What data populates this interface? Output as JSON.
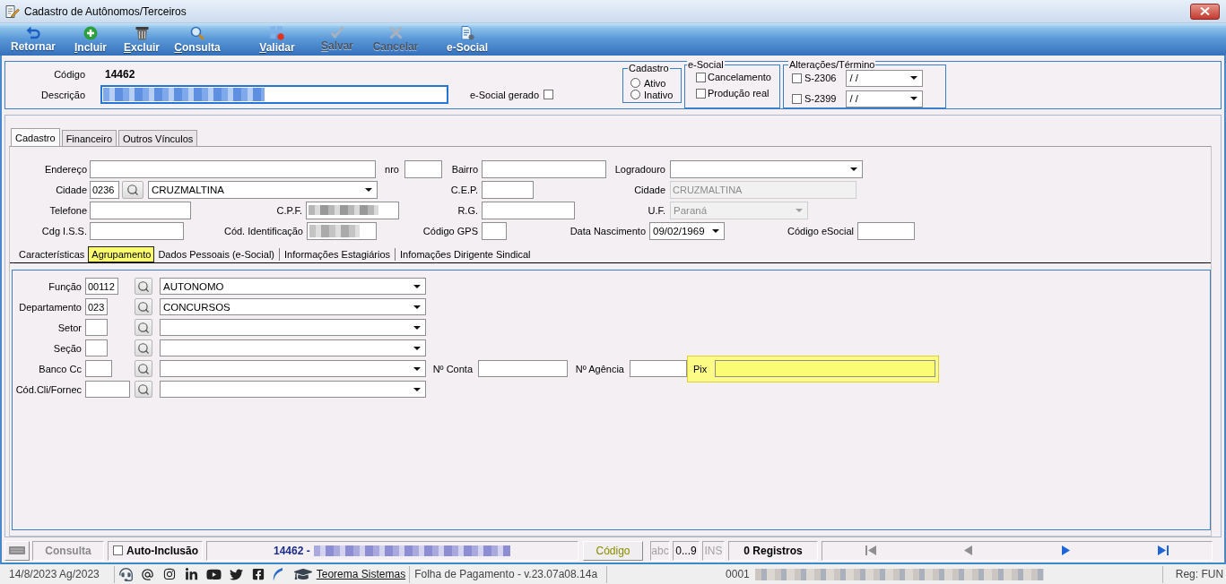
{
  "window": {
    "title": "Cadastro de Autônomos/Terceiros"
  },
  "toolbar": [
    {
      "kind": "return",
      "label": "Retornar",
      "disabled": false,
      "mnemonic": false
    },
    {
      "kind": "add",
      "label": "Incluir",
      "disabled": false,
      "mnemonic": true
    },
    {
      "kind": "delete",
      "label": "Excluir",
      "disabled": false,
      "mnemonic": true
    },
    {
      "kind": "search",
      "label": "Consulta",
      "disabled": false,
      "mnemonic": true
    },
    {
      "kind": "validate",
      "label": "Validar",
      "disabled": false,
      "mnemonic": true
    },
    {
      "kind": "save",
      "label": "Salvar",
      "disabled": true,
      "mnemonic": true
    },
    {
      "kind": "cancel",
      "label": "Cancelar",
      "disabled": true,
      "mnemonic": false
    },
    {
      "kind": "esocial",
      "label": "e-Social",
      "disabled": false,
      "mnemonic": false
    }
  ],
  "header": {
    "codigo": {
      "label": "Código",
      "value": "14462"
    },
    "descricao": {
      "label": "Descrição",
      "focused": true
    },
    "esocial_gerado": {
      "label": "e-Social gerado",
      "checked": false
    },
    "cadastro": {
      "title": "Cadastro",
      "options": [
        {
          "label": "Ativo",
          "selected": false
        },
        {
          "label": "Inativo",
          "selected": false
        }
      ]
    },
    "esocial": {
      "title": "e-Social",
      "options": [
        {
          "label": "Cancelamento",
          "checked": false
        },
        {
          "label": "Produção real",
          "checked": false
        }
      ]
    },
    "alteracoes": {
      "title": "Alterações/Término",
      "rows": [
        {
          "label": "S-2306",
          "checked": false,
          "value": "/ /"
        },
        {
          "label": "S-2399",
          "checked": false,
          "value": "/ /"
        }
      ]
    }
  },
  "tabs": [
    {
      "label": "Cadastro",
      "selected": true
    },
    {
      "label": "Financeiro",
      "selected": false
    },
    {
      "label": "Outros Vínculos",
      "selected": false
    }
  ],
  "cadastro": {
    "endereco": {
      "label": "Endereço"
    },
    "nro": {
      "label": "nro"
    },
    "bairro": {
      "label": "Bairro"
    },
    "logradouro": {
      "label": "Logradouro"
    },
    "cidade": {
      "label": "Cidade",
      "code": "0236",
      "value": "CRUZMALTINA"
    },
    "cep": {
      "label": "C.E.P."
    },
    "cidade_nome": {
      "label": "Cidade",
      "value": "CRUZMALTINA",
      "disabled": true
    },
    "telefone": {
      "label": "Telefone"
    },
    "cpf": {
      "label": "C.P.F."
    },
    "rg": {
      "label": "R.G."
    },
    "uf": {
      "label": "U.F.",
      "value": "Paraná",
      "disabled": true
    },
    "cdg_iss": {
      "label": "Cdg I.S.S."
    },
    "cod_identificacao": {
      "label": "Cód. Identificação"
    },
    "codigo_gps": {
      "label": "Código GPS"
    },
    "data_nascimento": {
      "label": "Data Nascimento",
      "value": "09/02/1969"
    },
    "codigo_esocial": {
      "label": "Código eSocial"
    }
  },
  "subtabs": [
    {
      "label": "Características",
      "selected": false
    },
    {
      "label": "Agrupamento",
      "selected": true
    },
    {
      "label": "Dados Pessoais (e-Social)",
      "selected": false
    },
    {
      "label": "Informações Estagiários",
      "selected": false
    },
    {
      "label": "Infomações Dirigente Sindical",
      "selected": false
    }
  ],
  "agrupamento": {
    "rows": [
      {
        "label": "Função",
        "code": "00112",
        "value": "AUTONOMO"
      },
      {
        "label": "Departamento",
        "code": "023",
        "value": "CONCURSOS"
      },
      {
        "label": "Setor"
      },
      {
        "label": "Seção"
      },
      {
        "label": "Banco Cc",
        "conta": {
          "label": "Nº Conta"
        },
        "agencia": {
          "label": "Nº Agência"
        },
        "pix": {
          "label": "Pix",
          "highlighted": true
        }
      },
      {
        "label": "Cód.Cli/Fornec"
      }
    ]
  },
  "status_bar": {
    "mode": "Consulta",
    "auto_inclusao": {
      "label": "Auto-Inclusão",
      "checked": false
    },
    "record": "14462 -",
    "codigo_button": "Código",
    "indicators": [
      {
        "label": "abc",
        "on": false
      },
      {
        "label": "0...9",
        "on": true
      },
      {
        "label": "INS",
        "on": false
      }
    ],
    "count": "0 Registros",
    "nav": [
      {
        "kind": "first",
        "disabled": true
      },
      {
        "kind": "prev",
        "disabled": true
      },
      {
        "kind": "next",
        "disabled": false
      },
      {
        "kind": "last",
        "disabled": false
      }
    ]
  },
  "info_bar": {
    "date": "14/8/2023 Ag/2023",
    "link": "Teorema Sistemas",
    "version": "Folha de Pagamento - v.23.07a08.14a",
    "company": "0001",
    "user": "Reg: FUN"
  }
}
